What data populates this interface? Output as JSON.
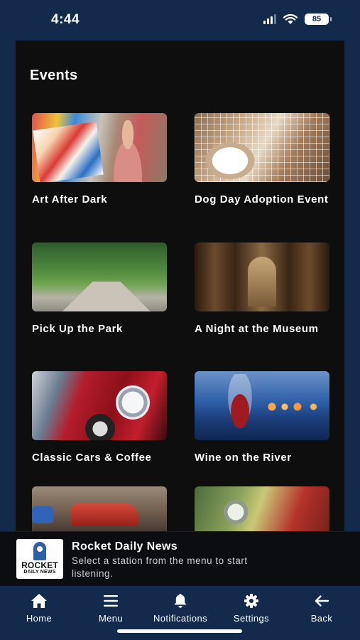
{
  "status_bar": {
    "time": "4:44",
    "battery": "85"
  },
  "section": {
    "title": "Events"
  },
  "events": [
    {
      "title": "Art After Dark"
    },
    {
      "title": "Dog Day Adoption Event"
    },
    {
      "title": "Pick Up the Park"
    },
    {
      "title": "A Night at the Museum"
    },
    {
      "title": "Classic Cars & Coffee"
    },
    {
      "title": "Wine on the River"
    }
  ],
  "player": {
    "logo_line1": "ROCKET",
    "logo_line2": "DAILY NEWS",
    "title": "Rocket Daily News",
    "subtitle": "Select a station from the menu to start listening."
  },
  "tabs": [
    {
      "label": "Home",
      "icon": "home-icon"
    },
    {
      "label": "Menu",
      "icon": "menu-icon"
    },
    {
      "label": "Notifications",
      "icon": "bell-icon"
    },
    {
      "label": "Settings",
      "icon": "gear-icon"
    },
    {
      "label": "Back",
      "icon": "arrow-left-icon"
    }
  ],
  "colors": {
    "nav_bg": "#142a4d",
    "content_bg": "#0e0e0f",
    "player_bg": "#0c0d10",
    "text": "#ffffff"
  }
}
